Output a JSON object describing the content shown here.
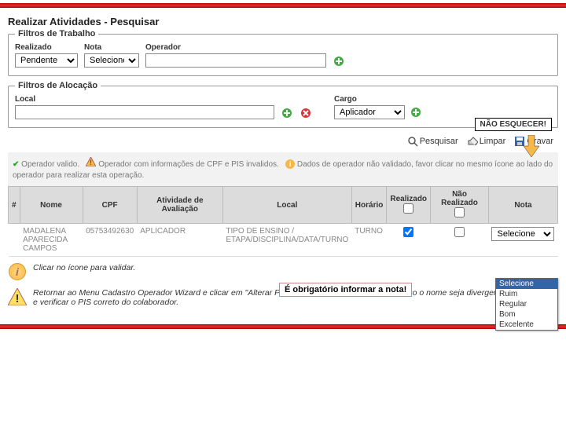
{
  "page": {
    "title": "Realizar Atividades - Pesquisar"
  },
  "filters": {
    "trabalho": {
      "legend": "Filtros de Trabalho",
      "realizado_label": "Realizado",
      "realizado_value": "Pendente",
      "nota_label": "Nota",
      "nota_value": "Selecione",
      "operador_label": "Operador",
      "operador_value": ""
    },
    "alocacao": {
      "legend": "Filtros de Alocação",
      "local_label": "Local",
      "local_value": "",
      "cargo_label": "Cargo",
      "cargo_value": "Aplicador"
    }
  },
  "callout": {
    "nao_esquecer": "NÃO ESQUECER!"
  },
  "actions": {
    "pesquisar": "Pesquisar",
    "limpar": "Limpar",
    "gravar": "Gravar"
  },
  "messages": {
    "valid": "Operador valido.",
    "cpf_pis": "Operador com informações de CPF e PIS invalidos.",
    "nao_validado": "Dados de operador não validado, favor clicar no mesmo ícone ao lado do operador para realizar esta operação."
  },
  "table": {
    "headers": {
      "num": "#",
      "nome": "Nome",
      "cpf": "CPF",
      "atividade": "Atividade de Avaliação",
      "local": "Local",
      "horario": "Horário",
      "realizado": "Realizado",
      "nao_realizado": "Não Realizado",
      "nota": "Nota"
    },
    "row": {
      "nome": "MADALENA APARECIDA CAMPOS",
      "cpf": "05753492630",
      "atividade": "APLICADOR",
      "local": "TIPO DE ENSINO / ETAPA/DISCIPLINA/DATA/TURNO",
      "horario": "TURNO",
      "realizado_checked": true,
      "nao_realizado_checked": false,
      "nota": "Selecione"
    }
  },
  "nota_options": [
    "Selecione",
    "Ruim",
    "Regular",
    "Bom",
    "Excelente"
  ],
  "notes": {
    "obrigatorio": "É obrigatório informar a nota!",
    "tip1": "Clicar no ícone para validar.",
    "tip2": "Retornar ao Menu Cadastro Operador Wizard e clicar em \"Alterar PIS\" , conferir os dados e gravar. Caso o nome seja divergente, ligar no 135 e verificar o PIS correto do colaborador."
  }
}
